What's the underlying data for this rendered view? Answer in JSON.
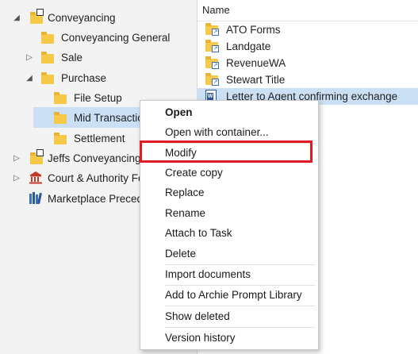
{
  "tree": {
    "items": [
      {
        "label": "Conveyancing"
      },
      {
        "label": "Conveyancing General"
      },
      {
        "label": "Sale"
      },
      {
        "label": "Purchase"
      },
      {
        "label": "File Setup"
      },
      {
        "label": "Mid Transactio"
      },
      {
        "label": "Settlement"
      },
      {
        "label": "Jeffs Conveyancing I"
      },
      {
        "label": "Court & Authority Fo"
      },
      {
        "label": "Marketplace Preced"
      }
    ]
  },
  "list": {
    "header": "Name",
    "items": [
      {
        "label": "ATO Forms"
      },
      {
        "label": "Landgate"
      },
      {
        "label": "RevenueWA"
      },
      {
        "label": "Stewart Title"
      },
      {
        "label": "Letter to Agent confirming exchange"
      }
    ]
  },
  "menu": {
    "items": [
      {
        "label": "Open"
      },
      {
        "label": "Open with container..."
      },
      {
        "label": "Modify"
      },
      {
        "label": "Create copy"
      },
      {
        "label": "Replace"
      },
      {
        "label": "Rename"
      },
      {
        "label": "Attach to Task"
      },
      {
        "label": "Delete"
      },
      {
        "label": "Import documents"
      },
      {
        "label": "Add to Archie Prompt Library"
      },
      {
        "label": "Show deleted"
      },
      {
        "label": "Version history"
      }
    ]
  },
  "colors": {
    "highlight": "#e01b24",
    "selection": "#cce0f5",
    "folder": "#f7c948"
  }
}
